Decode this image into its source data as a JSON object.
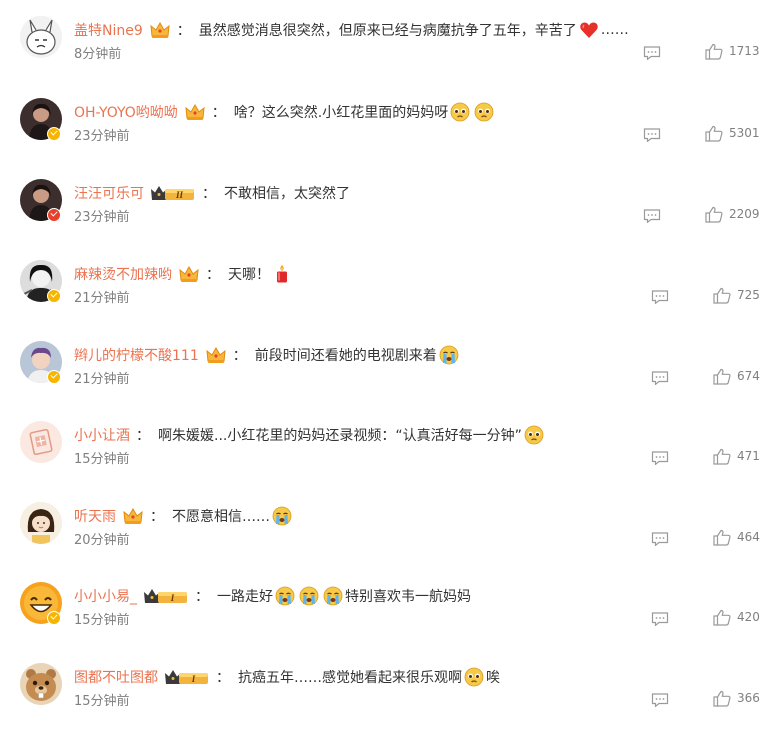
{
  "comments": [
    {
      "user": "盖特Nine9",
      "crown": "plain",
      "text": "虽然感觉消息很突然，但原来已经与病魔抗争了五年，辛苦了",
      "tail": "……",
      "emojis": [
        "heart"
      ],
      "time": "8分钟前",
      "likes": "1713",
      "avatar": "cartoon",
      "badge": "none"
    },
    {
      "user": "OH-YOYO哟呦呦",
      "crown": "plain",
      "text": "啥？这么突然.小红花里面的妈妈呀",
      "tail": "",
      "emojis": [
        "sad",
        "sad"
      ],
      "time": "23分钟前",
      "likes": "5301",
      "avatar": "dark",
      "badge": "gold"
    },
    {
      "user": "汪汪可乐可",
      "crown": "level-II",
      "text": "不敢相信，太突然了",
      "tail": "",
      "emojis": [],
      "time": "23分钟前",
      "likes": "2209",
      "avatar": "dark",
      "badge": "red"
    },
    {
      "user": "麻辣烫不加辣哟",
      "crown": "plain",
      "text": "天哪！",
      "tail": "",
      "emojis": [
        "candle"
      ],
      "time": "21分钟前",
      "likes": "725",
      "avatar": "bw",
      "badge": "gold"
    },
    {
      "user": "辫儿的柠檬不酸111",
      "crown": "plain",
      "text": "前段时间还看她的电视剧来着",
      "tail": "",
      "emojis": [
        "cry"
      ],
      "time": "21分钟前",
      "likes": "674",
      "avatar": "photo",
      "badge": "gold"
    },
    {
      "user": "小小让酒",
      "crown": "none",
      "text": "啊朱媛媛...小红花里的妈妈还录视频：“认真活好每一分钟”",
      "tail": "",
      "emojis": [
        "sad"
      ],
      "time": "15分钟前",
      "likes": "471",
      "avatar": "stamp",
      "badge": "none"
    },
    {
      "user": "听天雨",
      "crown": "plain",
      "text": "不愿意相信……",
      "tail": "",
      "emojis": [
        "cry"
      ],
      "time": "20分钟前",
      "likes": "464",
      "avatar": "girl",
      "badge": "none"
    },
    {
      "user": "小小小易_",
      "crown": "level-I",
      "text": "一路走好",
      "tail": "特别喜欢韦一航妈妈",
      "emojis": [
        "cry",
        "cry",
        "cry"
      ],
      "time": "15分钟前",
      "likes": "420",
      "avatar": "smile",
      "badge": "gold"
    },
    {
      "user": "图都不吐图都",
      "crown": "level-I",
      "text": "抗癌五年……感觉她看起来很乐观啊",
      "tail": "唉",
      "emojis": [
        "sad"
      ],
      "time": "15分钟前",
      "likes": "366",
      "avatar": "beaver",
      "badge": "none"
    }
  ],
  "separator": "：",
  "colors": {
    "username": "#eb7350",
    "text": "#333333",
    "meta": "#808080",
    "icon": "#9a9a9a"
  }
}
